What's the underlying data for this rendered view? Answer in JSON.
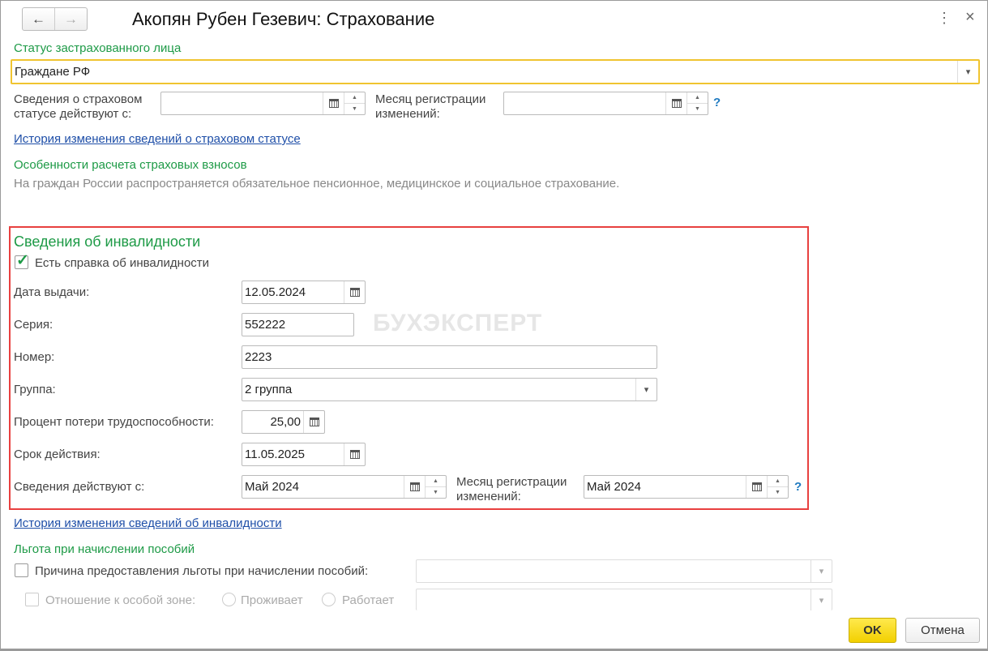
{
  "header": {
    "title": "Акопян Рубен Гезевич: Страхование",
    "back": "←",
    "forward": "→",
    "more": "⋮",
    "close": "×"
  },
  "status": {
    "label": "Статус застрахованного лица",
    "value": "Граждане РФ",
    "from_label": "Сведения о страховом статусе действуют с:",
    "from_value": "",
    "month_label": "Месяц регистрации изменений:",
    "month_value": "",
    "help": "?",
    "history_link": "История изменения сведений о страховом статусе"
  },
  "contrib": {
    "label": "Особенности расчета страховых взносов",
    "text": "На граждан России распространяется обязательное пенсионное, медицинское и социальное страхование."
  },
  "disability": {
    "title": "Сведения об инвалидности",
    "has_cert_label": "Есть справка об инвалидности",
    "has_cert": true,
    "issue_date_label": "Дата выдачи:",
    "issue_date": "12.05.2024",
    "series_label": "Серия:",
    "series": "552222",
    "number_label": "Номер:",
    "number": "2223",
    "group_label": "Группа:",
    "group": "2 группа",
    "percent_label": "Процент потери трудоспособности:",
    "percent": "25,00",
    "valid_label": "Срок действия:",
    "valid": "11.05.2025",
    "from_label": "Сведения действуют с:",
    "from": "Май 2024",
    "month_label": "Месяц регистрации изменений:",
    "month": "Май 2024",
    "help": "?"
  },
  "watermark": "БУХЭКСПЕРТ",
  "disability_history_link": "История изменения сведений об инвалидности",
  "benefit": {
    "label": "Льгота при начислении пособий",
    "reason_label": "Причина предоставления льготы при начислении пособий:",
    "reason_value": "",
    "zone_label": "Отношение к особой зоне:",
    "lives": "Проживает",
    "works": "Работает",
    "zone_value": ""
  },
  "footer": {
    "ok": "OK",
    "cancel": "Отмена"
  },
  "colors": {
    "accent_green": "#1d9a46",
    "highlight": "#e8403f",
    "ok_yellow": "#f5d800"
  }
}
